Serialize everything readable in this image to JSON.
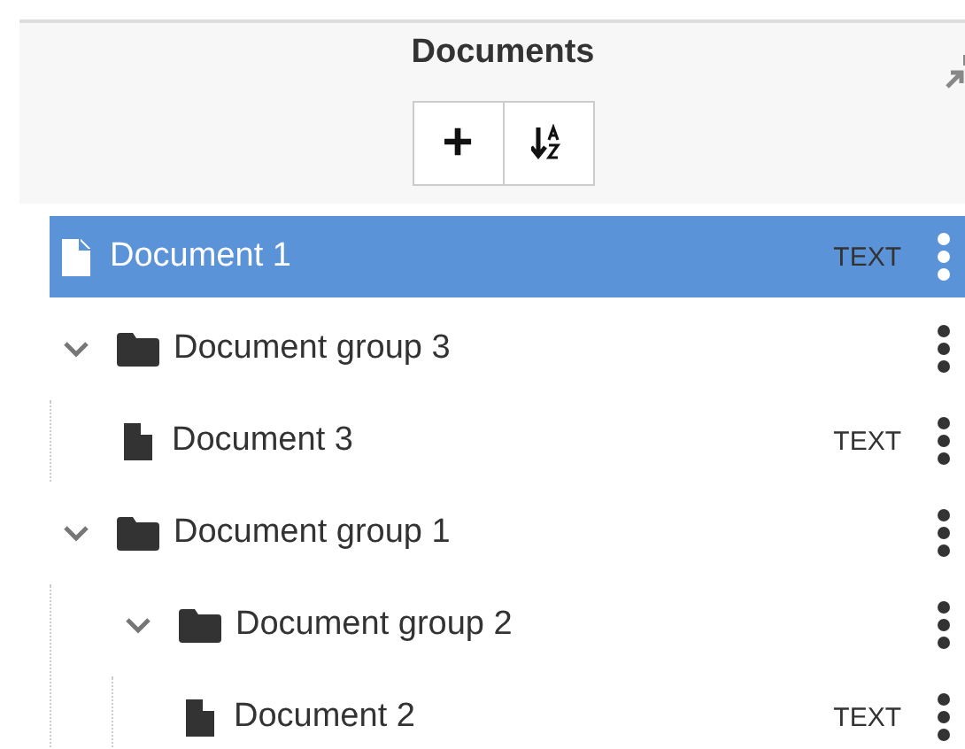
{
  "panel": {
    "title": "Documents"
  },
  "toolbar": {
    "buttons": [
      {
        "kind": "add",
        "label": "+"
      },
      {
        "kind": "sort"
      }
    ]
  },
  "tree": [
    {
      "kind": "document",
      "name": "Document 1",
      "type": "TEXT",
      "selected": true
    },
    {
      "kind": "group",
      "name": "Document group 3",
      "selected": false,
      "expanded": true,
      "children": [
        {
          "kind": "document",
          "name": "Document 3",
          "type": "TEXT",
          "selected": false
        }
      ]
    },
    {
      "kind": "group",
      "name": "Document group 1",
      "selected": false,
      "expanded": true,
      "children": [
        {
          "kind": "group",
          "name": "Document group 2",
          "selected": false,
          "expanded": true,
          "children": [
            {
              "kind": "document",
              "name": "Document 2",
              "type": "TEXT",
              "selected": false
            }
          ]
        }
      ]
    }
  ]
}
